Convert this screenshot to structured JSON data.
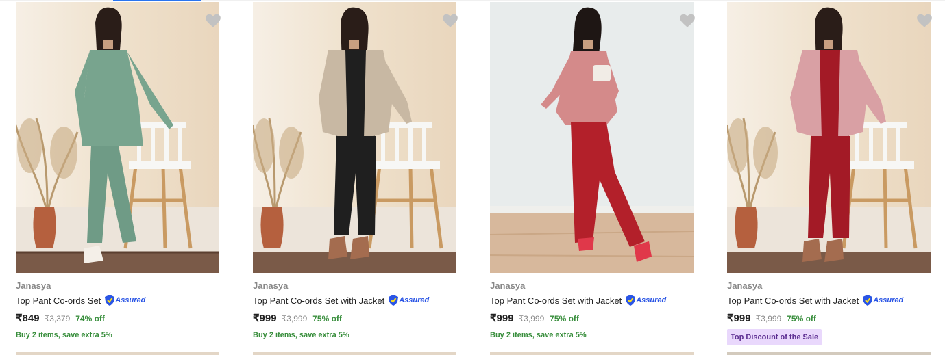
{
  "colors": {
    "accent": "#2874f0",
    "discount_green": "#388e3c",
    "assured_blue": "#2a55e5",
    "badge_bg": "#e9d8fc"
  },
  "products": [
    {
      "brand": "Janasya",
      "title": "Top Pant Co-ords Set",
      "assured": "Assured",
      "price": "₹849",
      "mrp": "₹3,379",
      "discount": "74% off",
      "offer": "Buy 2 items, save extra 5%",
      "badge": "",
      "image": {
        "bg": "light-beige",
        "outfit_top": "#78a48e",
        "outfit_bottom": "#78a48e",
        "background_wall": "#f1e5d4"
      }
    },
    {
      "brand": "Janasya",
      "title": "Top Pant Co-ords Set with Jacket",
      "assured": "Assured",
      "price": "₹999",
      "mrp": "₹3,999",
      "discount": "75% off",
      "offer": "Buy 2 items, save extra 5%",
      "badge": "",
      "image": {
        "bg": "light-beige",
        "outfit_top": "#c8b8a3",
        "outfit_bottom": "#1f1f1f",
        "background_wall": "#f1e5d4"
      }
    },
    {
      "brand": "Janasya",
      "title": "Top Pant Co-ords Set with Jacket",
      "assured": "Assured",
      "price": "₹999",
      "mrp": "₹3,999",
      "discount": "75% off",
      "offer": "Buy 2 items, save extra 5%",
      "badge": "",
      "image": {
        "bg": "pale-grey",
        "outfit_top": "#d48a8a",
        "outfit_bottom": "#b3202a",
        "background_wall": "#e6eaea"
      }
    },
    {
      "brand": "Janasya",
      "title": "Top Pant Co-ords Set with Jacket",
      "assured": "Assured",
      "price": "₹999",
      "mrp": "₹3,999",
      "discount": "75% off",
      "offer": "",
      "badge": "Top Discount of the Sale",
      "image": {
        "bg": "light-beige",
        "outfit_top": "#d9a0a4",
        "outfit_bottom": "#a31a26",
        "background_wall": "#f1e5d4"
      }
    }
  ]
}
